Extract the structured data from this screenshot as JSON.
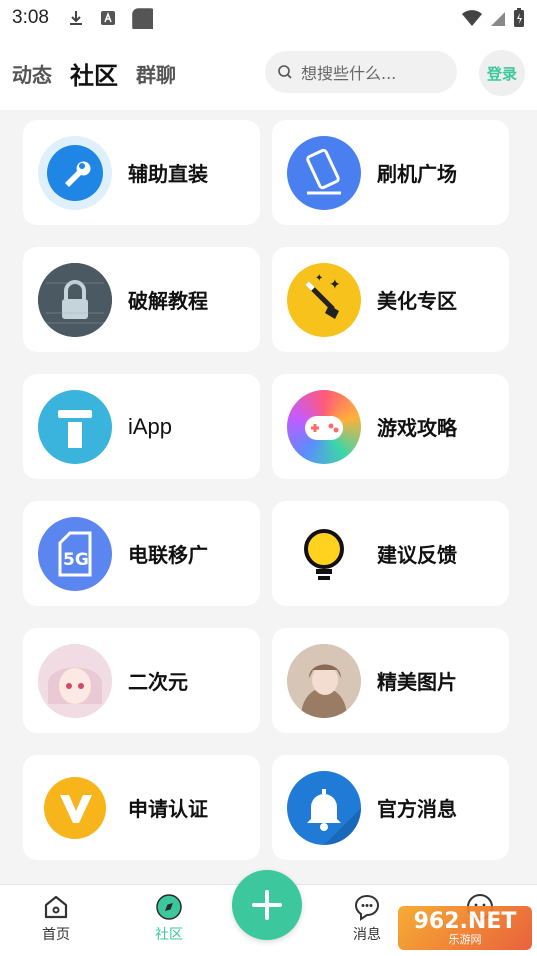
{
  "status_bar": {
    "time": "3:08"
  },
  "header": {
    "tabs": [
      {
        "label": "动态",
        "active": false
      },
      {
        "label": "社区",
        "active": true
      },
      {
        "label": "群聊",
        "active": false
      }
    ],
    "search_placeholder": "想搜些什么...",
    "login_label": "登录"
  },
  "grid": {
    "items": [
      {
        "label": "辅助直装",
        "icon": "wrench-icon"
      },
      {
        "label": "刷机广场",
        "icon": "phone-icon"
      },
      {
        "label": "破解教程",
        "icon": "lock-icon"
      },
      {
        "label": "美化专区",
        "icon": "magic-wand-icon"
      },
      {
        "label": "iApp",
        "icon": "iapp-icon"
      },
      {
        "label": "游戏攻略",
        "icon": "gamepad-icon"
      },
      {
        "label": "电联移广",
        "icon": "5g-icon"
      },
      {
        "label": "建议反馈",
        "icon": "lightbulb-icon"
      },
      {
        "label": "二次元",
        "icon": "anime-avatar-icon"
      },
      {
        "label": "精美图片",
        "icon": "photo-avatar-icon"
      },
      {
        "label": "申请认证",
        "icon": "v-badge-icon"
      },
      {
        "label": "官方消息",
        "icon": "bell-icon"
      }
    ]
  },
  "bottom_nav": {
    "items": [
      {
        "label": "首页",
        "icon": "home-icon",
        "active": false
      },
      {
        "label": "社区",
        "icon": "compass-icon",
        "active": true
      },
      {
        "label": "消息",
        "icon": "chat-icon",
        "active": false
      }
    ],
    "fab_icon": "plus-icon"
  },
  "watermark": {
    "top": "962.NET",
    "bottom": "乐游网"
  },
  "colors": {
    "accent": "#3cc89c",
    "background": "#f4f4f4"
  }
}
